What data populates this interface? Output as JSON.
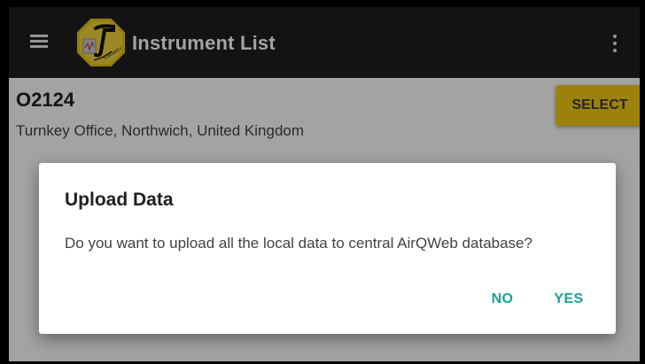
{
  "appbar": {
    "title": "Instrument List",
    "menu_icon": "hamburger-menu-icon",
    "overflow_icon": "more-vert-icon",
    "logo_text": "TURNKEY",
    "background": "#1f1f1f"
  },
  "instrument": {
    "code": "O2124",
    "location": "Turnkey Office, Northwich, United Kingdom",
    "select_label": "SELECT",
    "select_color": "#f4cc14"
  },
  "dialog": {
    "title": "Upload Data",
    "message": "Do you want to upload all the local data to central AirQWeb database?",
    "no_label": "NO",
    "yes_label": "YES",
    "accent": "#17a398"
  }
}
